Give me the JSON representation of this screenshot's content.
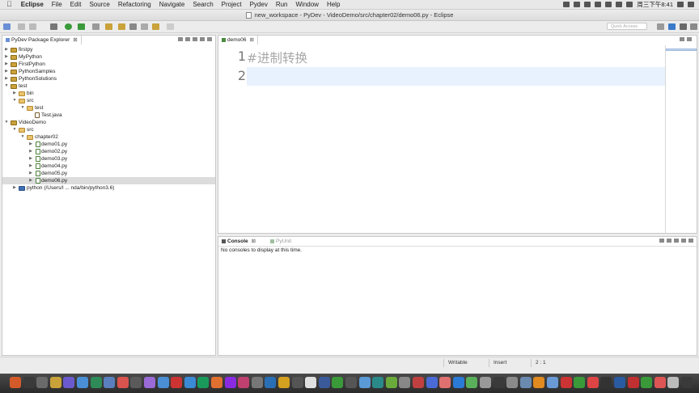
{
  "menubar": {
    "app": "Eclipse",
    "items": [
      "File",
      "Edit",
      "Source",
      "Refactoring",
      "Navigate",
      "Search",
      "Project",
      "Pydev",
      "Run",
      "Window",
      "Help"
    ],
    "clock": "周三下午8:41"
  },
  "window": {
    "title": "new_workspace - PyDev - VideoDemo/src/chapter02/demo06.py - Eclipse"
  },
  "toolbar": {
    "quick_access_placeholder": "Quick Access"
  },
  "explorer": {
    "tab_label": "PyDev Package Explorer",
    "items": [
      {
        "label": "firstpy"
      },
      {
        "label": "MyPython"
      },
      {
        "label": "FirstPython"
      },
      {
        "label": "PythonSamples"
      },
      {
        "label": "PythonSolutions"
      },
      {
        "label": "test"
      },
      {
        "label": "bin"
      },
      {
        "label": "src"
      },
      {
        "label": "test"
      },
      {
        "label": "Test.java"
      },
      {
        "label": "VideoDemo"
      },
      {
        "label": "src"
      },
      {
        "label": "chapter02"
      },
      {
        "label": "demo01.py"
      },
      {
        "label": "demo02.py"
      },
      {
        "label": "demo03.py"
      },
      {
        "label": "demo04.py"
      },
      {
        "label": "demo05.py"
      },
      {
        "label": "demo06.py"
      },
      {
        "label": "python  (/Users/l ... nda/bin/python3.6)"
      }
    ]
  },
  "editor": {
    "tab_label": "demo06",
    "lines": [
      {
        "num": "1",
        "text": "#进制转换"
      },
      {
        "num": "2",
        "text": ""
      }
    ]
  },
  "console": {
    "tab_console": "Console",
    "tab_pyunit": "PyUnit",
    "message": "No consoles to display at this time."
  },
  "statusbar": {
    "writable": "Writable",
    "insert": "Insert",
    "position": "2 : 1"
  }
}
